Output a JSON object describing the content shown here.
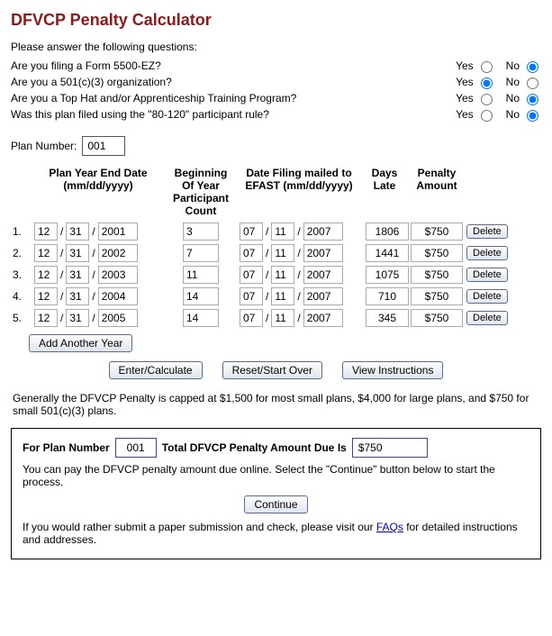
{
  "title": "DFVCP Penalty Calculator",
  "intro": "Please answer the following questions:",
  "questions": [
    {
      "text": "Are you filing a Form 5500-EZ?",
      "yes": "Yes",
      "no": "No",
      "answer": "no"
    },
    {
      "text": "Are you a 501(c)(3) organization?",
      "yes": "Yes",
      "no": "No",
      "answer": "yes"
    },
    {
      "text": "Are you a Top Hat and/or Apprenticeship Training Program?",
      "yes": "Yes",
      "no": "No",
      "answer": "no"
    },
    {
      "text": "Was this plan filed using the \"80-120\" participant rule?",
      "yes": "Yes",
      "no": "No",
      "answer": "no"
    }
  ],
  "planNumberLabel": "Plan Number:",
  "planNumber": "001",
  "headers": {
    "planYear": "Plan Year End Date (mm/dd/yyyy)",
    "begCount": "Beginning Of Year Participant Count",
    "mailed": "Date Filing mailed to EFAST (mm/dd/yyyy)",
    "daysLate": "Days Late",
    "penalty": "Penalty Amount"
  },
  "rows": [
    {
      "n": "1.",
      "pm": "12",
      "pd": "31",
      "py": "2001",
      "count": "3",
      "mm": "07",
      "md": "11",
      "my": "2007",
      "days": "1806",
      "pen": "$750"
    },
    {
      "n": "2.",
      "pm": "12",
      "pd": "31",
      "py": "2002",
      "count": "7",
      "mm": "07",
      "md": "11",
      "my": "2007",
      "days": "1441",
      "pen": "$750"
    },
    {
      "n": "3.",
      "pm": "12",
      "pd": "31",
      "py": "2003",
      "count": "11",
      "mm": "07",
      "md": "11",
      "my": "2007",
      "days": "1075",
      "pen": "$750"
    },
    {
      "n": "4.",
      "pm": "12",
      "pd": "31",
      "py": "2004",
      "count": "14",
      "mm": "07",
      "md": "11",
      "my": "2007",
      "days": "710",
      "pen": "$750"
    },
    {
      "n": "5.",
      "pm": "12",
      "pd": "31",
      "py": "2005",
      "count": "14",
      "mm": "07",
      "md": "11",
      "my": "2007",
      "days": "345",
      "pen": "$750"
    }
  ],
  "deleteLabel": "Delete",
  "addAnother": "Add Another Year",
  "buttons": {
    "calc": "Enter/Calculate",
    "reset": "Reset/Start Over",
    "instr": "View Instructions"
  },
  "note": "Generally the DFVCP Penalty is capped at $1,500 for most small plans, $4,000 for large plans, and $750 for small 501(c)(3) plans.",
  "result": {
    "forPlan": "For Plan Number",
    "planVal": "001",
    "totalLabel": "Total DFVCP Penalty Amount Due Is",
    "totalVal": "$750",
    "payText": "You can pay the DFVCP penalty amount due online. Select the \"Continue\" button below to start the process.",
    "continue": "Continue",
    "paperPre": "If you would rather submit a paper submission and check, please visit our ",
    "faqs": "FAQs",
    "paperPost": " for detailed instructions and addresses."
  }
}
